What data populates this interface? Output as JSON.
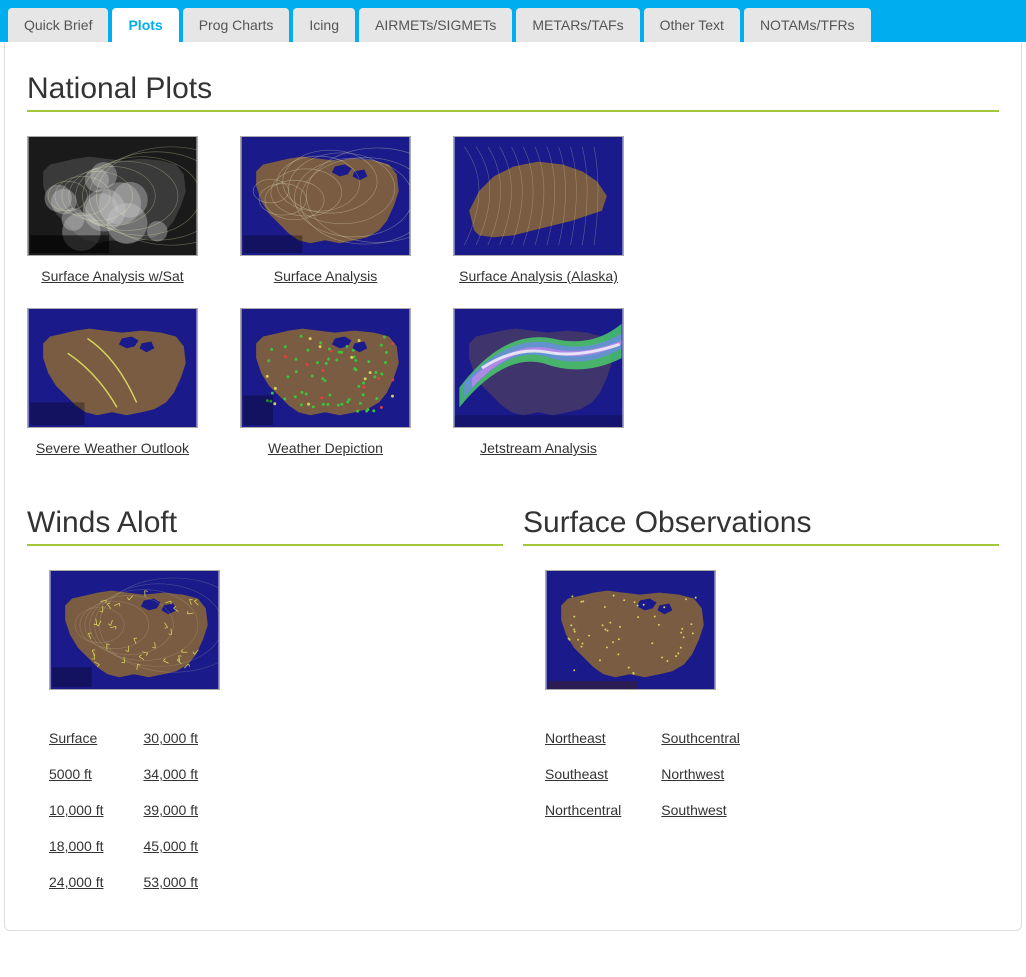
{
  "tabs": [
    {
      "label": "Quick Brief",
      "active": false
    },
    {
      "label": "Plots",
      "active": true
    },
    {
      "label": "Prog Charts",
      "active": false
    },
    {
      "label": "Icing",
      "active": false
    },
    {
      "label": "AIRMETs/SIGMETs",
      "active": false
    },
    {
      "label": "METARs/TAFs",
      "active": false
    },
    {
      "label": "Other Text",
      "active": false
    },
    {
      "label": "NOTAMs/TFRs",
      "active": false
    }
  ],
  "sections": {
    "national_plots": {
      "title": "National Plots",
      "items": [
        {
          "label": "Surface Analysis w/Sat",
          "style": "sat"
        },
        {
          "label": "Surface Analysis",
          "style": "conus"
        },
        {
          "label": "Surface Analysis (Alaska)",
          "style": "alaska"
        },
        {
          "label": "Severe Weather Outlook",
          "style": "severe"
        },
        {
          "label": "Weather Depiction",
          "style": "depict"
        },
        {
          "label": "Jetstream Analysis",
          "style": "jet"
        }
      ]
    },
    "winds_aloft": {
      "title": "Winds Aloft",
      "thumb_style": "winds",
      "columns": [
        [
          "Surface",
          "5000 ft",
          "10,000 ft",
          "18,000 ft",
          "24,000 ft"
        ],
        [
          "30,000 ft",
          "34,000 ft",
          "39,000 ft",
          "45,000 ft",
          "53,000 ft"
        ]
      ]
    },
    "surface_obs": {
      "title": "Surface Observations",
      "thumb_style": "obs",
      "columns": [
        [
          "Northeast",
          "Southeast",
          "Northcentral"
        ],
        [
          "Southcentral",
          "Northwest",
          "Southwest"
        ]
      ]
    }
  }
}
